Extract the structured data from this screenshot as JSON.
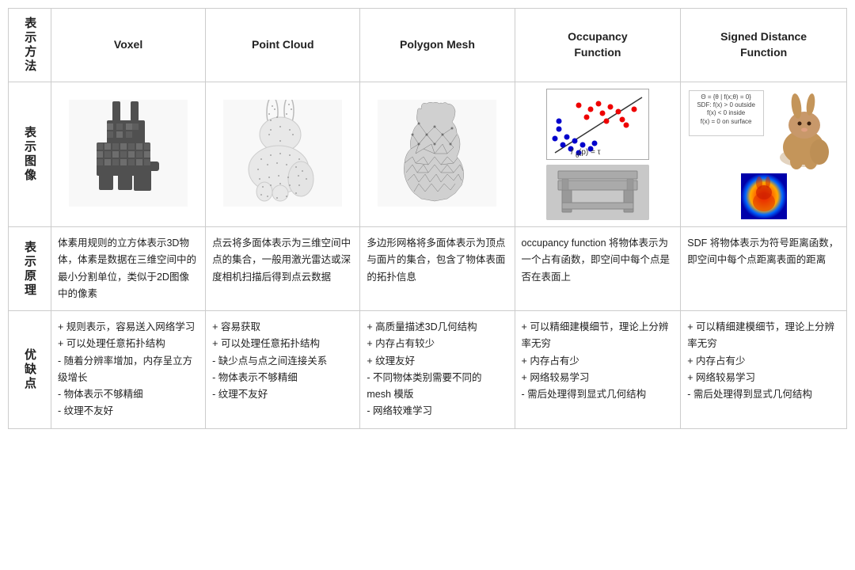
{
  "table": {
    "row_headers": [
      "表示方法",
      "表示图像",
      "表示原理",
      "优缺点"
    ],
    "col_headers": [
      "Voxel",
      "Point Cloud",
      "Polygon Mesh",
      "Occupancy\nFunction",
      "Signed Distance\nFunction"
    ],
    "principles": [
      "体素用规则的立方体表示3D物体，体素是数据在三维空间中的最小分割单位，类似于2D图像中的像素",
      "点云将多面体表示为三维空间中点的集合，一般用激光雷达或深度相机扫描后得到点云数据",
      "多边形网格将多面体表示为顶点与面片的集合，包含了物体表面的拓扑信息",
      "occupancy function 将物体表示为一个占有函数，即空间中每个点是否在表面上",
      "SDF 将物体表示为符号距离函数，即空间中每个点距离表面的距离"
    ],
    "pros_cons": [
      "+ 规则表示，容易送入网络学习\n+ 可以处理任意拓扑结构\n- 随着分辨率增加，内存呈立方级增长\n- 物体表示不够精细\n- 纹理不友好",
      "+ 容易获取\n+ 可以处理任意拓扑结构\n- 缺少点与点之间连接关系\n- 物体表示不够精细\n- 纹理不友好",
      "+ 高质量描述3D几何结构\n+ 内存占有较少\n+ 纹理友好\n- 不同物体类别需要不同的 mesh 模版\n- 网络较难学习",
      "+ 可以精细建模细节，理论上分辨率无穷\n+ 内存占有少\n+ 网络较易学习\n- 需后处理得到显式几何结构",
      "+ 可以精细建模细节，理论上分辨率无穷\n+ 内存占有少\n+ 网络较易学习\n- 需后处理得到显式几何结构"
    ]
  }
}
